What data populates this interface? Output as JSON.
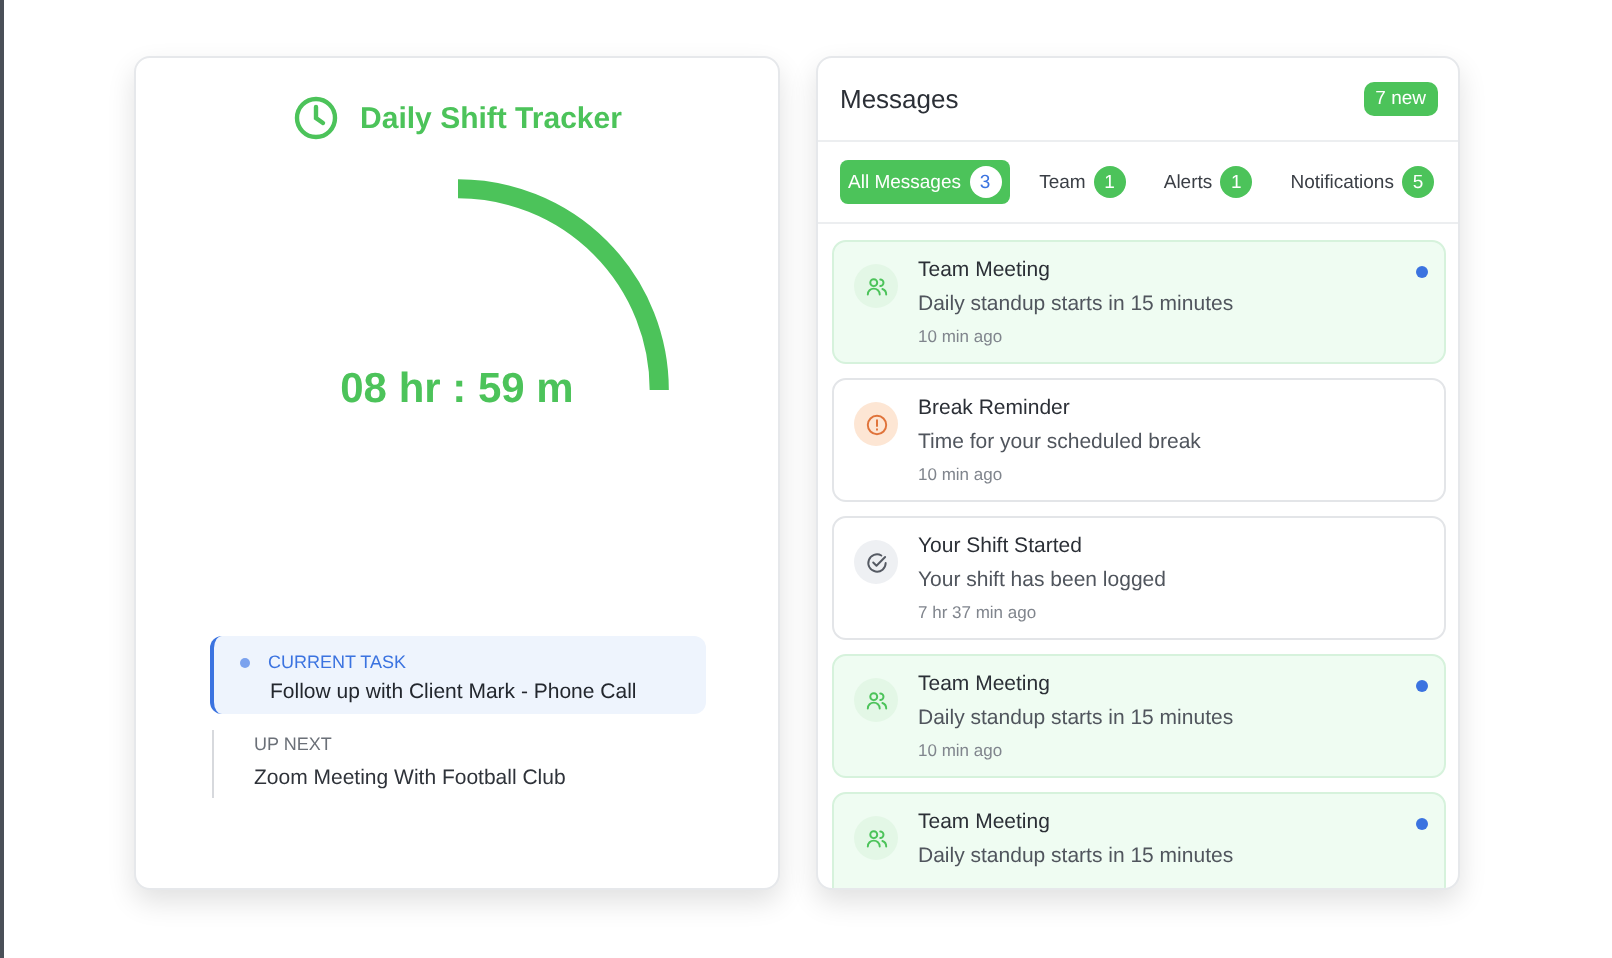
{
  "tracker": {
    "title": "Daily Shift Tracker",
    "time": "08 hr : 59 m",
    "current_task": {
      "label": "CURRENT TASK",
      "text": "Follow up with Client Mark - Phone Call"
    },
    "up_next": {
      "label": "UP NEXT",
      "text": "Zoom Meeting With Football Club"
    }
  },
  "messages": {
    "title": "Messages",
    "badge": "7 new",
    "tabs": [
      {
        "label": "All Messages",
        "count": "3",
        "selected": true
      },
      {
        "label": "Team",
        "count": "1",
        "selected": false
      },
      {
        "label": "Alerts",
        "count": "1",
        "selected": false
      },
      {
        "label": "Notifications",
        "count": "5",
        "selected": false
      }
    ],
    "items": [
      {
        "kind": "team",
        "title": "Team Meeting",
        "text": "Daily standup starts in 15 minutes",
        "time": "10 min ago",
        "unread": true
      },
      {
        "kind": "alert",
        "title": "Break Reminder",
        "text": "Time for your scheduled break",
        "time": "10 min ago",
        "unread": false
      },
      {
        "kind": "shift",
        "title": "Your Shift Started",
        "text": "Your shift has been logged",
        "time": "7 hr 37 min ago",
        "unread": false
      },
      {
        "kind": "team",
        "title": "Team Meeting",
        "text": "Daily standup starts in 15 minutes",
        "time": "10 min ago",
        "unread": true
      },
      {
        "kind": "team",
        "title": "Team Meeting",
        "text": "Daily standup starts in 15 minutes",
        "unread": true
      }
    ]
  }
}
